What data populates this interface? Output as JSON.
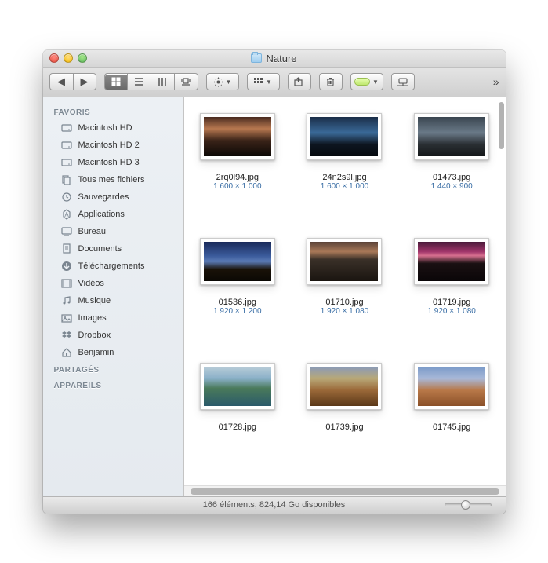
{
  "window": {
    "title": "Nature"
  },
  "sidebar": {
    "sections": [
      {
        "header": "Favoris",
        "items": [
          {
            "icon": "hdd",
            "label": "Macintosh HD"
          },
          {
            "icon": "hdd",
            "label": "Macintosh HD 2"
          },
          {
            "icon": "hdd",
            "label": "Macintosh HD 3"
          },
          {
            "icon": "allfiles",
            "label": "Tous mes fichiers"
          },
          {
            "icon": "time",
            "label": "Sauvegardes"
          },
          {
            "icon": "apps",
            "label": "Applications"
          },
          {
            "icon": "desktop",
            "label": "Bureau"
          },
          {
            "icon": "docs",
            "label": "Documents"
          },
          {
            "icon": "download",
            "label": "Téléchargements"
          },
          {
            "icon": "movies",
            "label": "Vidéos"
          },
          {
            "icon": "music",
            "label": "Musique"
          },
          {
            "icon": "pictures",
            "label": "Images"
          },
          {
            "icon": "dropbox",
            "label": "Dropbox"
          },
          {
            "icon": "home",
            "label": "Benjamin"
          }
        ]
      },
      {
        "header": "Partagés",
        "items": []
      },
      {
        "header": "Appareils",
        "items": []
      }
    ]
  },
  "files": [
    {
      "name": "2rq0l94.jpg",
      "dim": "1 600 × 1 000",
      "g": "g1"
    },
    {
      "name": "24n2s9l.jpg",
      "dim": "1 600 × 1 000",
      "g": "g2"
    },
    {
      "name": "01473.jpg",
      "dim": "1 440 × 900",
      "g": "g3"
    },
    {
      "name": "01536.jpg",
      "dim": "1 920 × 1 200",
      "g": "g4"
    },
    {
      "name": "01710.jpg",
      "dim": "1 920 × 1 080",
      "g": "g5"
    },
    {
      "name": "01719.jpg",
      "dim": "1 920 × 1 080",
      "g": "g6"
    },
    {
      "name": "01728.jpg",
      "dim": "",
      "g": "g7"
    },
    {
      "name": "01739.jpg",
      "dim": "",
      "g": "g8"
    },
    {
      "name": "01745.jpg",
      "dim": "",
      "g": "g9"
    }
  ],
  "status": "166 éléments, 824,14 Go disponibles"
}
